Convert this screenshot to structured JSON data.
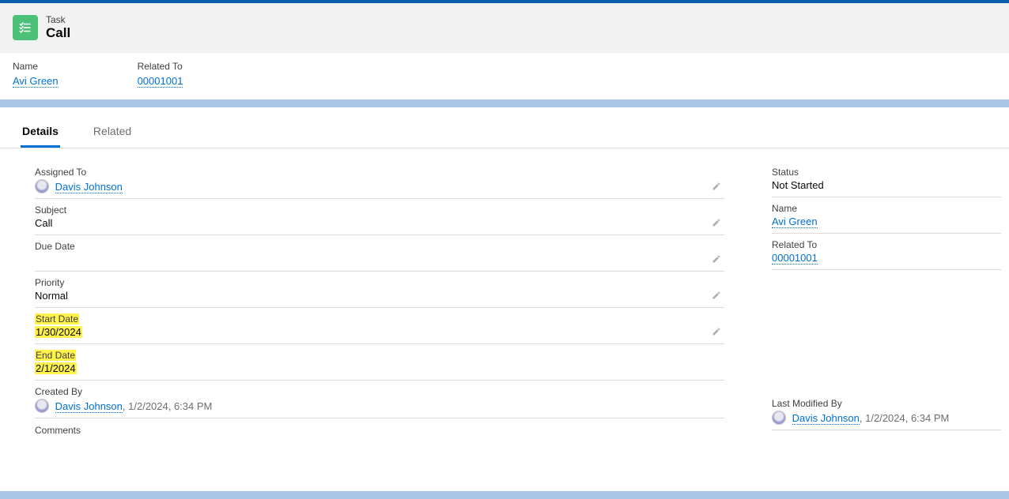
{
  "header": {
    "entity": "Task",
    "title": "Call"
  },
  "summary": {
    "name_label": "Name",
    "name_value": "Avi Green",
    "related_label": "Related To",
    "related_value": "00001001"
  },
  "tabs": {
    "details": "Details",
    "related": "Related"
  },
  "details": {
    "assigned_to_label": "Assigned To",
    "assigned_to_value": "Davis Johnson",
    "subject_label": "Subject",
    "subject_value": "Call",
    "due_date_label": "Due Date",
    "due_date_value": "",
    "priority_label": "Priority",
    "priority_value": "Normal",
    "start_date_label": "Start Date",
    "start_date_value": "1/30/2024",
    "end_date_label": "End Date",
    "end_date_value": "2/1/2024",
    "created_by_label": "Created By",
    "created_by_value": "Davis Johnson",
    "created_by_ts": ", 1/2/2024, 6:34 PM",
    "comments_label": "Comments"
  },
  "side": {
    "status_label": "Status",
    "status_value": "Not Started",
    "name_label": "Name",
    "name_value": "Avi Green",
    "related_label": "Related To",
    "related_value": "00001001",
    "last_modified_label": "Last Modified By",
    "last_modified_value": "Davis Johnson",
    "last_modified_ts": ", 1/2/2024, 6:34 PM"
  }
}
